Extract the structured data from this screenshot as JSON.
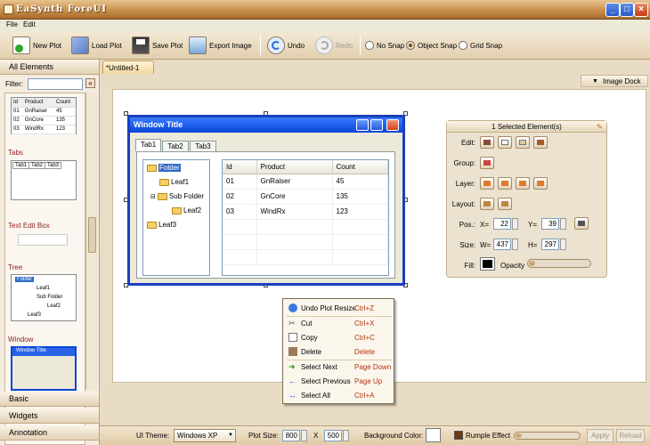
{
  "window": {
    "title": "EaSynth ForeUI"
  },
  "menu": {
    "file": "File",
    "edit": "Edit"
  },
  "toolbar": {
    "new_plot": "New Plot",
    "load_plot": "Load Plot",
    "save_plot": "Save Plot",
    "export_image": "Export Image",
    "undo": "Undo",
    "redo": "Redo",
    "no_snap": "No Snap",
    "object_snap": "Object Snap",
    "grid_snap": "Grid Snap"
  },
  "left_panel": {
    "all_elements": "All Elements",
    "filter_label": "Filter:",
    "filter_value": "",
    "table_headers": [
      "Id",
      "Product",
      "Count"
    ],
    "table_rows": [
      [
        "01",
        "GnRaiser",
        "45"
      ],
      [
        "02",
        "GnCore",
        "135"
      ],
      [
        "03",
        "WindRx",
        "123"
      ]
    ],
    "tabs_title": "Tabs",
    "tabs": [
      "Tab1",
      "Tab2",
      "Tab3"
    ],
    "textedit_title": "Text Edit Box",
    "tree_title": "Tree",
    "tree_nodes": [
      "Folder",
      "Leaf1",
      "Sub Folder",
      "Leaf2",
      "Leaf3"
    ],
    "window_title": "Window",
    "window_preview_title": "Window Title",
    "basic": "Basic",
    "widgets": "Widgets",
    "annotation": "Annotation"
  },
  "document": {
    "tab": "*Untitled-1",
    "image_dock": "Image Dock"
  },
  "design_window": {
    "title": "Window Title",
    "tabs": [
      "Tab1",
      "Tab2",
      "Tab3"
    ],
    "tree": [
      "Folder",
      "Leaf1",
      "Sub Folder",
      "Leaf2",
      "Leaf3"
    ],
    "grid_headers": [
      "Id",
      "Product",
      "Count"
    ],
    "grid_rows": [
      [
        "01",
        "GnRaiser",
        "45"
      ],
      [
        "02",
        "GnCore",
        "135"
      ],
      [
        "03",
        "WindRx",
        "123"
      ]
    ]
  },
  "properties": {
    "header": "1 Selected Element(s)",
    "edit": "Edit:",
    "group": "Group:",
    "layer": "Layer:",
    "layout": "Layout:",
    "pos": "Pos.:",
    "x_label": "X=",
    "x": "22",
    "y_label": "Y=",
    "y": "39",
    "size": "Size:",
    "w_label": "W=",
    "w": "437",
    "h_label": "H=",
    "h": "297",
    "fill": "Fill:",
    "opacity": "Opacity"
  },
  "context_menu": [
    {
      "label": "Undo Plot Resize",
      "shortcut": "Ctrl+Z",
      "icon": "undo-icon"
    },
    {
      "label": "Cut",
      "shortcut": "Ctrl+X",
      "icon": "cut-icon"
    },
    {
      "label": "Copy",
      "shortcut": "Ctrl+C",
      "icon": "copy-icon"
    },
    {
      "label": "Delete",
      "shortcut": "Delete",
      "icon": "delete-icon"
    },
    {
      "label": "Select Next",
      "shortcut": "Page Down",
      "icon": "arrow-right-icon"
    },
    {
      "label": "Select Previous",
      "shortcut": "Page Up",
      "icon": "arrow-left-icon"
    },
    {
      "label": "Select All",
      "shortcut": "Ctrl+A",
      "icon": "select-all-icon"
    }
  ],
  "status": {
    "ui_theme_label": "UI Theme:",
    "ui_theme": "Windows XP",
    "plot_size_label": "Plot Size:",
    "plot_w": "800",
    "x": "X",
    "plot_h": "500",
    "bg_color_label": "Background Color:",
    "rumple": "Rumple Effect",
    "apply": "Apply",
    "reload": "Reload"
  },
  "colors": {
    "accent": "#c58b47",
    "xp_blue": "#0a45d8",
    "menu_shortcut": "#b1340f"
  }
}
